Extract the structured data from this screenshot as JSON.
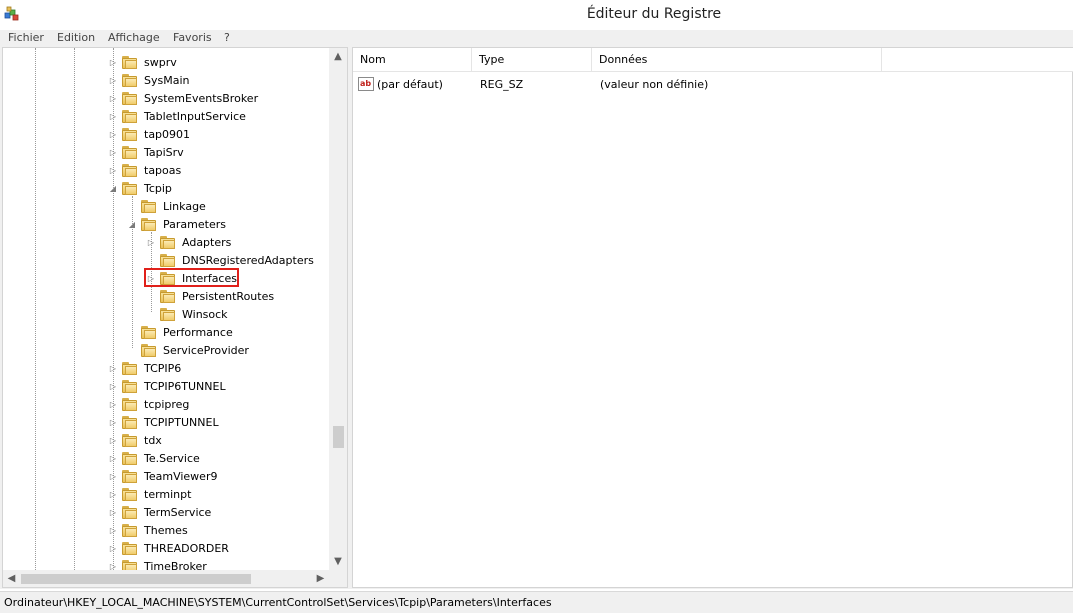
{
  "window": {
    "title": "Éditeur du Registre",
    "icon": "registry-editor-icon"
  },
  "menu": [
    "Fichier",
    "Edition",
    "Affichage",
    "Favoris",
    "?"
  ],
  "tree": {
    "nodes": [
      {
        "label": "swprv",
        "expander": "collapsed"
      },
      {
        "label": "SysMain",
        "expander": "collapsed"
      },
      {
        "label": "SystemEventsBroker",
        "expander": "collapsed"
      },
      {
        "label": "TabletInputService",
        "expander": "collapsed"
      },
      {
        "label": "tap0901",
        "expander": "collapsed"
      },
      {
        "label": "TapiSrv",
        "expander": "collapsed"
      },
      {
        "label": "tapoas",
        "expander": "collapsed"
      },
      {
        "label": "Tcpip",
        "expander": "expanded"
      },
      {
        "label": "Linkage",
        "expander": "none"
      },
      {
        "label": "Parameters",
        "expander": "expanded"
      },
      {
        "label": "Adapters",
        "expander": "collapsed"
      },
      {
        "label": "DNSRegisteredAdapters",
        "expander": "none"
      },
      {
        "label": "Interfaces",
        "expander": "collapsed",
        "highlighted": true
      },
      {
        "label": "PersistentRoutes",
        "expander": "none"
      },
      {
        "label": "Winsock",
        "expander": "none"
      },
      {
        "label": "Performance",
        "expander": "none"
      },
      {
        "label": "ServiceProvider",
        "expander": "none"
      },
      {
        "label": "TCPIP6",
        "expander": "collapsed"
      },
      {
        "label": "TCPIP6TUNNEL",
        "expander": "collapsed"
      },
      {
        "label": "tcpipreg",
        "expander": "collapsed"
      },
      {
        "label": "TCPIPTUNNEL",
        "expander": "collapsed"
      },
      {
        "label": "tdx",
        "expander": "collapsed"
      },
      {
        "label": "Te.Service",
        "expander": "collapsed"
      },
      {
        "label": "TeamViewer9",
        "expander": "collapsed"
      },
      {
        "label": "terminpt",
        "expander": "collapsed"
      },
      {
        "label": "TermService",
        "expander": "collapsed"
      },
      {
        "label": "Themes",
        "expander": "collapsed"
      },
      {
        "label": "THREADORDER",
        "expander": "collapsed"
      },
      {
        "label": "TimeBroker",
        "expander": "collapsed"
      }
    ]
  },
  "list": {
    "columns": [
      "Nom",
      "Type",
      "Données"
    ],
    "rows": [
      {
        "icon": "string-value-icon",
        "icon_text": "ab",
        "name": "(par défaut)",
        "type": "REG_SZ",
        "data": "(valeur non définie)"
      }
    ]
  },
  "status": {
    "path": "Ordinateur\\HKEY_LOCAL_MACHINE\\SYSTEM\\CurrentControlSet\\Services\\Tcpip\\Parameters\\Interfaces"
  },
  "colors": {
    "highlight_border": "#e0201a",
    "folder": "#e9c158"
  }
}
